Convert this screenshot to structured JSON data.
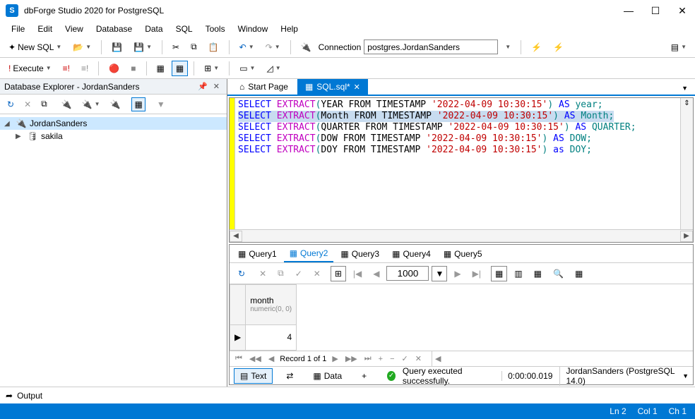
{
  "window": {
    "title": "dbForge Studio 2020 for PostgreSQL",
    "logo_letter": "S"
  },
  "menu": [
    "File",
    "Edit",
    "View",
    "Database",
    "Data",
    "SQL",
    "Tools",
    "Window",
    "Help"
  ],
  "toolbar1": {
    "new_sql": "New SQL",
    "connection_label": "Connection",
    "connection_value": "postgres.JordanSanders"
  },
  "toolbar2": {
    "execute": "Execute"
  },
  "explorer": {
    "title": "Database Explorer - JordanSanders",
    "root": "JordanSanders",
    "db": "sakila"
  },
  "doc_tabs": {
    "start_page": "Start Page",
    "sql_file": "SQL.sql*"
  },
  "code_lines": [
    {
      "kw": "SELECT",
      "fn": "EXTRACT",
      "open": "(",
      "part": "YEAR",
      "from": " FROM TIMESTAMP ",
      "str": "'2022-04-09 10:30:15'",
      "close": ")",
      "as": " AS ",
      "alias": "year",
      "end": ";",
      "selected": false
    },
    {
      "kw": "SELECT",
      "fn": "EXTRACT",
      "open": "(",
      "part": "Month",
      "from": " FROM TIMESTAMP ",
      "str": "'2022-04-09 10:30:15'",
      "close": ")",
      "as": " AS ",
      "alias": "Month",
      "end": ";",
      "selected": true
    },
    {
      "kw": "SELECT",
      "fn": "EXTRACT",
      "open": "(",
      "part": "QUARTER",
      "from": " FROM TIMESTAMP ",
      "str": "'2022-04-09 10:30:15'",
      "close": ")",
      "as": " AS ",
      "alias": "QUARTER",
      "end": ";",
      "selected": false
    },
    {
      "kw": "SELECT",
      "fn": "EXTRACT",
      "open": "(",
      "part": "DOW",
      "from": " FROM TIMESTAMP ",
      "str": "'2022-04-09 10:30:15'",
      "close": ")",
      "as": " AS ",
      "alias": "DOW",
      "end": ";",
      "selected": false
    },
    {
      "kw": "SELECT",
      "fn": "EXTRACT",
      "open": "(",
      "part": "DOY",
      "from": " FROM TIMESTAMP ",
      "str": "'2022-04-09 10:30:15'",
      "close": ")",
      "as": " as ",
      "alias": "DOY",
      "end": ";",
      "selected": false
    }
  ],
  "query_tabs": [
    "Query1",
    "Query2",
    "Query3",
    "Query4",
    "Query5"
  ],
  "query_active": 1,
  "grid": {
    "page_size": "1000",
    "column": "month",
    "column_type": "numeric(0, 0)",
    "cell": "4",
    "record": "Record 1 of 1"
  },
  "result_bar": {
    "text": "Text",
    "data": "Data",
    "ok_msg": "Query executed successfully.",
    "time": "0:00:00.019",
    "conn": "JordanSanders (PostgreSQL 14.0)"
  },
  "bottom": {
    "output": "Output"
  },
  "status": {
    "ln": "Ln 2",
    "col": "Col 1",
    "ch": "Ch 1"
  }
}
